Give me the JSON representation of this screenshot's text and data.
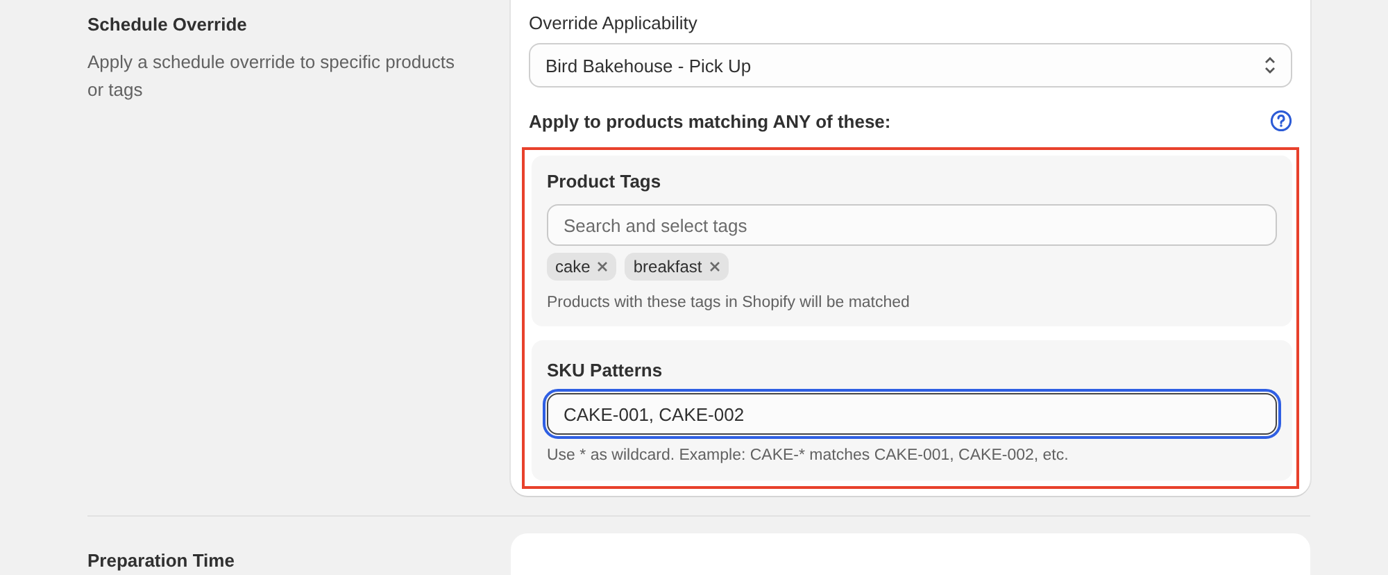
{
  "section": {
    "title": "Schedule Override",
    "description": "Apply a schedule override to specific products or tags"
  },
  "override_applicability": {
    "label": "Override Applicability",
    "value": "Bird Bakehouse - Pick Up"
  },
  "match_heading": "Apply to products matching ANY of these:",
  "matchers": {
    "highlighted": true,
    "product_tags": {
      "title": "Product Tags",
      "placeholder": "Search and select tags",
      "tags": [
        "cake",
        "breakfast"
      ],
      "help": "Products with these tags in Shopify will be matched"
    },
    "sku_patterns": {
      "title": "SKU Patterns",
      "value": "CAKE-001, CAKE-002",
      "focused": true,
      "help": "Use * as wildcard. Example: CAKE-* matches CAKE-001, CAKE-002, etc."
    }
  },
  "next_section": {
    "title": "Preparation Time"
  }
}
